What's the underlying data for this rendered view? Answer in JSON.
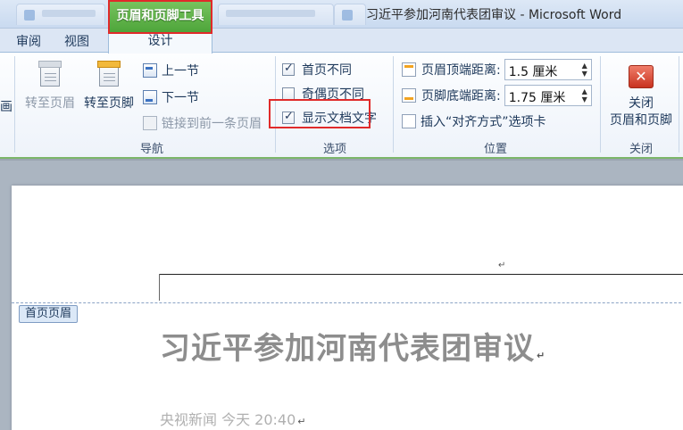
{
  "titlebar": {
    "context_tab_label": "页眉和页脚工具",
    "window_title": "习近平参加河南代表团审议 - Microsoft Word"
  },
  "ribbon_tabs": {
    "review": "审阅",
    "view": "视图",
    "design": "设计"
  },
  "navigation": {
    "goto_header": "转至页眉",
    "goto_footer": "转至页脚",
    "previous_section": "上一节",
    "next_section": "下一节",
    "link_to_previous": "链接到前一条页眉",
    "group_label": "导航",
    "partial_left": "画"
  },
  "options": {
    "different_first_page": {
      "label": "首页不同",
      "checked": true
    },
    "different_odd_even": {
      "label": "奇偶页不同",
      "checked": false
    },
    "show_document_text": {
      "label": "显示文档文字",
      "checked": true
    },
    "group_label": "选项"
  },
  "position": {
    "header_top_label": "页眉顶端距离:",
    "header_top_value": "1.5 厘米",
    "footer_bottom_label": "页脚底端距离:",
    "footer_bottom_value": "1.75 厘米",
    "insert_align_tab": "插入“对齐方式”选项卡",
    "group_label": "位置"
  },
  "close": {
    "line1": "关闭",
    "line2": "页眉和页脚",
    "group_label": "关闭"
  },
  "document": {
    "header_label": "首页页眉",
    "title": "习近平参加河南代表团审议",
    "meta": "央视新闻 今天 20:40"
  },
  "icons": {
    "paragraph_mark": "↵",
    "close_x": "✕"
  },
  "colors": {
    "context_tab_green": "#4ea53a",
    "highlight_red": "#e02a2a",
    "title_gray": "#8d8d8d"
  }
}
